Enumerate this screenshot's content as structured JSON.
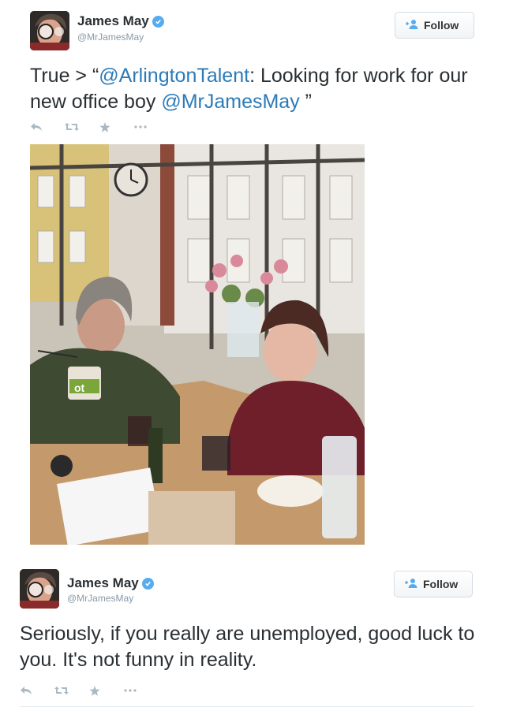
{
  "tweets": [
    {
      "name": "James May",
      "handle": "@MrJamesMay",
      "follow_label": "Follow",
      "text_before": "True > “",
      "mention_1": "@ArlingtonTalent",
      "text_middle": ": Looking for work for our new office boy ",
      "mention_2": "@MrJamesMay",
      "text_after": " ”",
      "photo_label": "ot",
      "icons": [
        "reply-icon",
        "retweet-icon",
        "favorite-icon",
        "more-icon"
      ]
    },
    {
      "name": "James May",
      "handle": "@MrJamesMay",
      "follow_label": "Follow",
      "text": "Seriously, if you really are unemployed, good luck to you. It's not funny in reality.",
      "icons": [
        "reply-icon",
        "retweet-icon",
        "favorite-icon",
        "more-icon"
      ]
    }
  ],
  "colors": {
    "mention": "#2b7bb9",
    "verified": "#55acee",
    "handle": "#8899a6",
    "icon": "#aab8c2"
  }
}
